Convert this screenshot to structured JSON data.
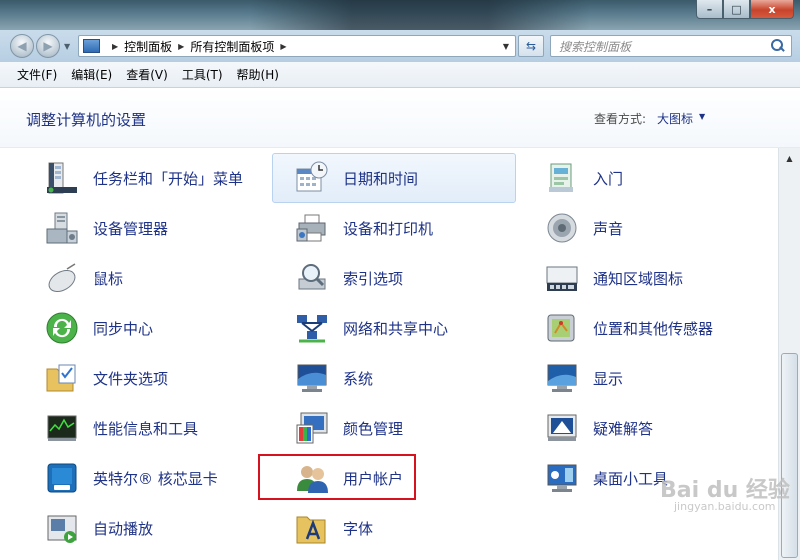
{
  "window": {
    "minimize_glyph": "–",
    "maximize_glyph": "□",
    "close_glyph": "x"
  },
  "navbar": {
    "breadcrumbs": [
      "控制面板",
      "所有控制面板项"
    ],
    "search_placeholder": "搜索控制面板"
  },
  "menu": [
    "文件(F)",
    "编辑(E)",
    "查看(V)",
    "工具(T)",
    "帮助(H)"
  ],
  "header": {
    "title": "调整计算机的设置",
    "view_label": "查看方式:",
    "view_value": "大图标"
  },
  "items": [
    {
      "label": "任务栏和「开始」菜单",
      "icon": "taskbar-icon"
    },
    {
      "label": "日期和时间",
      "icon": "calendar-clock-icon"
    },
    {
      "label": "入门",
      "icon": "getting-started-icon"
    },
    {
      "label": "设备管理器",
      "icon": "device-manager-icon"
    },
    {
      "label": "设备和打印机",
      "icon": "printer-icon"
    },
    {
      "label": "声音",
      "icon": "speaker-icon"
    },
    {
      "label": "鼠标",
      "icon": "mouse-icon"
    },
    {
      "label": "索引选项",
      "icon": "index-search-icon"
    },
    {
      "label": "通知区域图标",
      "icon": "notification-area-icon"
    },
    {
      "label": "同步中心",
      "icon": "sync-icon"
    },
    {
      "label": "网络和共享中心",
      "icon": "network-icon"
    },
    {
      "label": "位置和其他传感器",
      "icon": "location-sensor-icon"
    },
    {
      "label": "文件夹选项",
      "icon": "folder-options-icon"
    },
    {
      "label": "系统",
      "icon": "system-icon"
    },
    {
      "label": "显示",
      "icon": "display-icon"
    },
    {
      "label": "性能信息和工具",
      "icon": "performance-icon"
    },
    {
      "label": "颜色管理",
      "icon": "color-management-icon"
    },
    {
      "label": "疑难解答",
      "icon": "troubleshooting-icon"
    },
    {
      "label": "英特尔® 核芯显卡",
      "icon": "intel-graphics-icon"
    },
    {
      "label": "用户帐户",
      "icon": "user-accounts-icon"
    },
    {
      "label": "桌面小工具",
      "icon": "desktop-gadgets-icon"
    },
    {
      "label": "自动播放",
      "icon": "autoplay-icon"
    },
    {
      "label": "字体",
      "icon": "fonts-icon"
    }
  ],
  "watermark": {
    "text": "Bai du 经验",
    "sub": "jingyan.baidu.com"
  }
}
